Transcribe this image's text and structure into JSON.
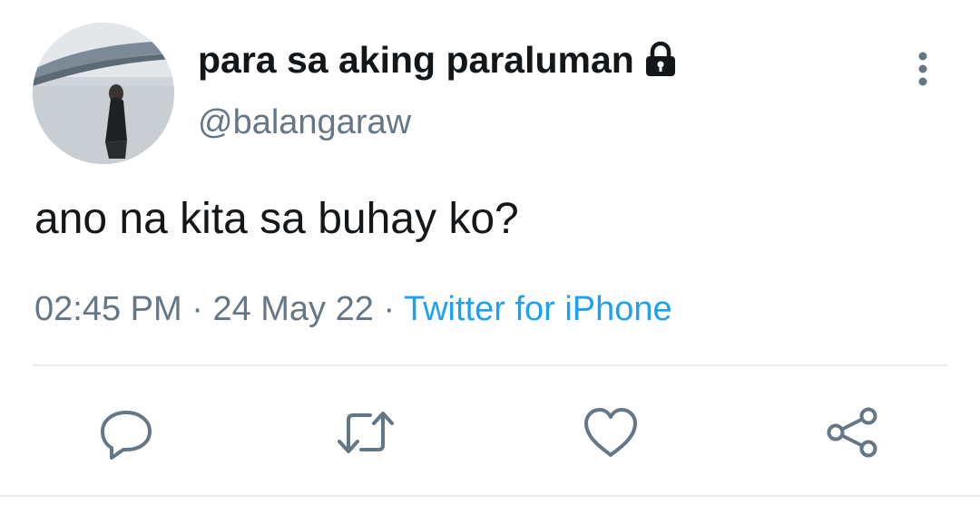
{
  "author": {
    "display_name": "para sa aking paraluman",
    "handle": "@balangaraw",
    "avatar": "avatar-photo",
    "protected_icon": "lock-icon"
  },
  "tweet": {
    "text": "ano na kita sa buhay ko?",
    "time": "02:45 PM",
    "separator1": " · ",
    "date": "24 May 22",
    "separator2": " · ",
    "source": "Twitter for iPhone"
  },
  "header": {
    "more_icon": "more-vertical-icon"
  },
  "actions": [
    {
      "name": "reply",
      "icon": "reply-icon"
    },
    {
      "name": "retweet",
      "icon": "retweet-icon"
    },
    {
      "name": "like",
      "icon": "heart-icon"
    },
    {
      "name": "share",
      "icon": "share-icon"
    }
  ],
  "colors": {
    "text_primary": "#14171a",
    "text_secondary": "#657786",
    "link": "#1da1f2",
    "icon": "#657786",
    "divider": "#e6ecf0"
  }
}
